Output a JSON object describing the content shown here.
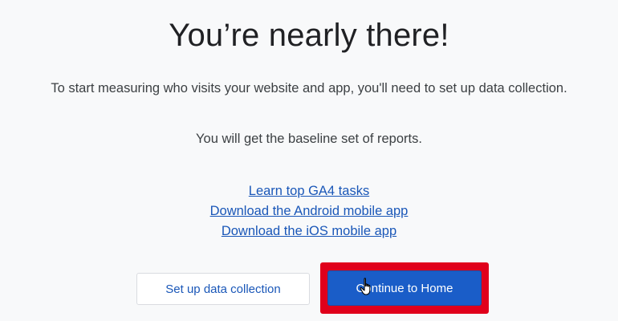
{
  "title": "You’re nearly there!",
  "description": "To start measuring who visits your website and app, you'll need to set up data collection.",
  "subtext": "You will get the baseline set of reports.",
  "links": [
    {
      "label": "Learn top GA4 tasks"
    },
    {
      "label": "Download the Android mobile app"
    },
    {
      "label": "Download the iOS mobile app"
    }
  ],
  "buttons": {
    "setup_label": "Set up data collection",
    "continue_label": "Continue to Home"
  },
  "colors": {
    "link": "#1a57b8",
    "primary_button": "#1a5dc8",
    "highlight_box": "#e0001b"
  },
  "icons": {
    "cursor": "hand-pointer-icon"
  }
}
